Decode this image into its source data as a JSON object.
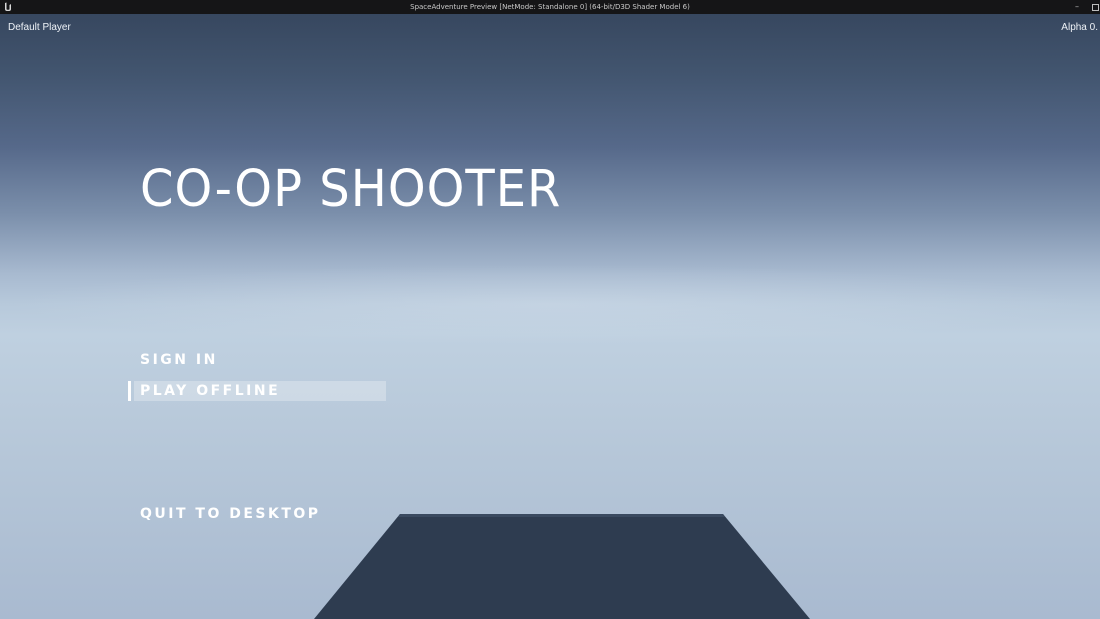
{
  "window": {
    "title": "SpaceAdventure Preview [NetMode: Standalone 0]  (64-bit/D3D Shader Model 6)",
    "minimize_glyph": "–",
    "logo_icon": "unreal-logo-icon"
  },
  "hud": {
    "player_name": "Default Player",
    "version": "Alpha 0."
  },
  "game_title": "CO-OP SHOOTER",
  "menu": {
    "items": [
      {
        "label": "SIGN IN",
        "selected": false
      },
      {
        "label": "PLAY OFFLINE",
        "selected": true
      },
      {
        "label": "QUIT TO DESKTOP",
        "selected": false
      }
    ]
  },
  "colors": {
    "sky_top": "#37475f",
    "sky_horizon": "#bfd0e0",
    "platform": "#2e3c50",
    "text": "#ffffff"
  }
}
